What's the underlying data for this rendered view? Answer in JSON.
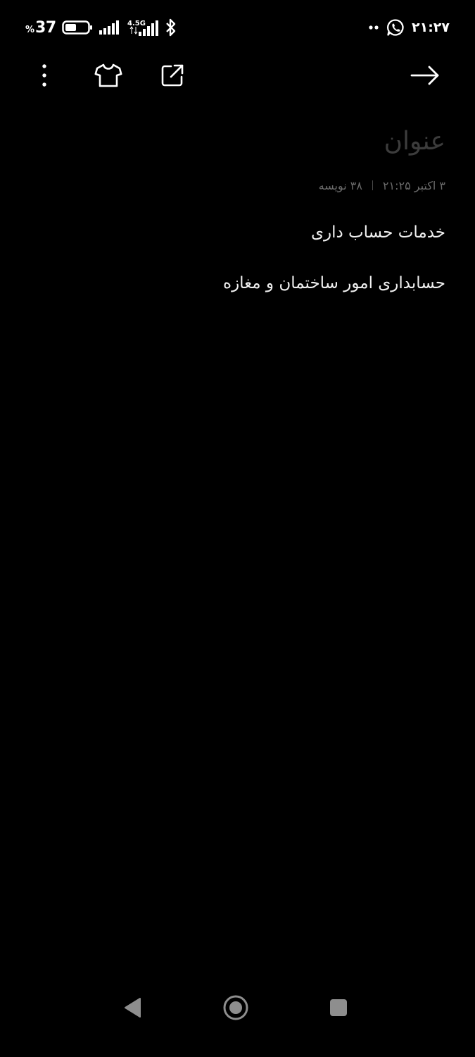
{
  "status_bar": {
    "battery_percent_sign": "%",
    "battery_percent": "37",
    "network_type": "4.5G",
    "clock": "۲۱:۲۷",
    "icons": [
      "battery-icon",
      "signal-icon",
      "signal-4-5g-icon",
      "bluetooth-icon",
      "more-notifications-icon",
      "whatsapp-icon"
    ]
  },
  "toolbar": {
    "icons": [
      "more-vertical-icon",
      "tshirt-icon",
      "share-external-icon",
      "arrow-forward-icon"
    ]
  },
  "note": {
    "title_placeholder": "عنوان",
    "date": "۳ اکتبر ۲۱:۲۵",
    "char_count": "۳۸ نویسه",
    "lines": [
      "خدمات حساب داری",
      "حسابداری امور ساختمان و مغازه"
    ]
  },
  "nav_bar": {
    "icons": [
      "back-triangle-icon",
      "home-circle-icon",
      "recents-square-icon"
    ],
    "color": "#8e8e8e"
  },
  "colors": {
    "background": "#000000",
    "text_primary": "#f0f0f0",
    "placeholder": "#3c3c3c",
    "meta": "#6a6a6a"
  }
}
